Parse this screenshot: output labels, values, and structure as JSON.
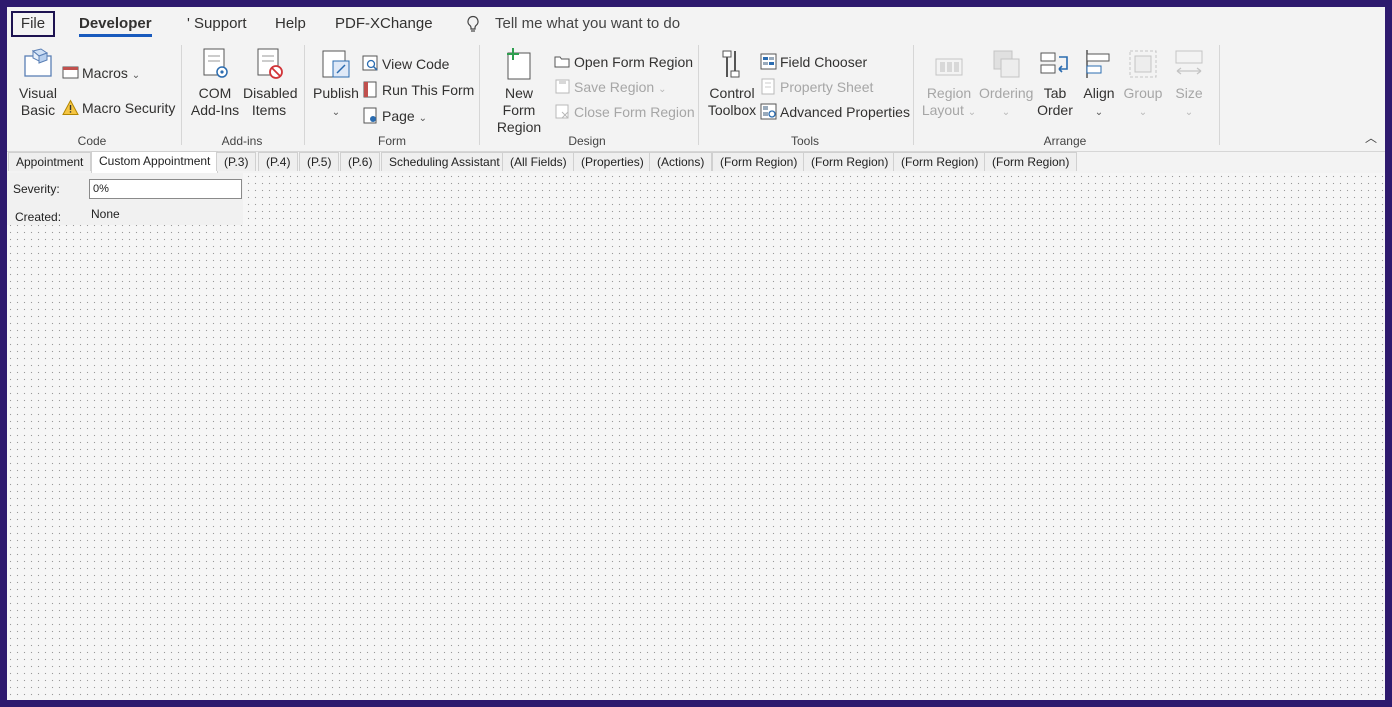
{
  "tabs": {
    "file": "File",
    "developer": "Developer",
    "support": "' Support",
    "help": "Help",
    "pdfxchange": "PDF-XChange",
    "tell_me": "Tell me what you want to do"
  },
  "ribbon": {
    "code": {
      "label": "Code",
      "visual_basic": "Visual Basic",
      "macros": "Macros",
      "macro_security": "Macro Security"
    },
    "addins": {
      "label": "Add-ins",
      "com_addins": "COM Add-Ins",
      "disabled_items": "Disabled Items"
    },
    "form": {
      "label": "Form",
      "publish": "Publish",
      "view_code": "View Code",
      "run_this_form": "Run This Form",
      "page": "Page"
    },
    "design": {
      "label": "Design",
      "new_form_region": "New Form Region",
      "open_form_region": "Open Form Region",
      "save_region": "Save Region",
      "close_form_region": "Close Form Region"
    },
    "tools": {
      "label": "Tools",
      "control_toolbox": "Control Toolbox",
      "field_chooser": "Field Chooser",
      "property_sheet": "Property Sheet",
      "advanced_properties": "Advanced Properties"
    },
    "arrange": {
      "label": "Arrange",
      "region_layout": "Region Layout",
      "ordering": "Ordering",
      "tab_order": "Tab Order",
      "align": "Align",
      "group": "Group",
      "size": "Size"
    }
  },
  "page_tabs": [
    "Appointment",
    "Custom Appointment",
    "(P.3)",
    "(P.4)",
    "(P.5)",
    "(P.6)",
    "Scheduling Assistant",
    "(All Fields)",
    "(Properties)",
    "(Actions)",
    "(Form Region)",
    "(Form Region)",
    "(Form Region)",
    "(Form Region)"
  ],
  "form": {
    "severity_label": "Severity:",
    "severity_value": "0%",
    "created_label": "Created:",
    "created_value": "None"
  },
  "colors": {
    "accent": "#185abd",
    "frame": "#2e1a6e"
  },
  "icons": {
    "collapse": "chevron-up-icon",
    "caret": "chevron-down-icon"
  }
}
